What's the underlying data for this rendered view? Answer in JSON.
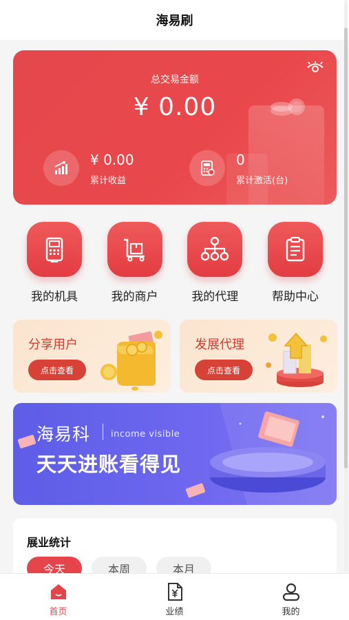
{
  "header": {
    "title": "海易刷"
  },
  "summary": {
    "total_label": "总交易金额",
    "total_amount": "¥ 0.00",
    "earnings_value": "¥ 0.00",
    "earnings_label": "累计收益",
    "activations_value": "0",
    "activations_label": "累计激活(台)"
  },
  "actions": [
    {
      "label": "我的机具",
      "icon": "pos-terminal-icon"
    },
    {
      "label": "我的商户",
      "icon": "cart-icon"
    },
    {
      "label": "我的代理",
      "icon": "network-icon"
    },
    {
      "label": "帮助中心",
      "icon": "clipboard-icon"
    }
  ],
  "promos": [
    {
      "title": "分享用户",
      "button": "点击查看"
    },
    {
      "title": "发展代理",
      "button": "点击查看"
    }
  ],
  "banner": {
    "brand": "海易科",
    "english": "income visible",
    "slogan": "天天进账看得见"
  },
  "stats": {
    "title": "展业统计",
    "tabs": [
      "今天",
      "本周",
      "本月"
    ],
    "active_tab": 0
  },
  "nav": [
    {
      "label": "首页",
      "icon": "home-icon",
      "active": true
    },
    {
      "label": "业绩",
      "icon": "document-yen-icon",
      "active": false
    },
    {
      "label": "我的",
      "icon": "user-icon",
      "active": false
    }
  ],
  "colors": {
    "primary": "#e5454a",
    "banner": "#6663ec",
    "promo_bg": "#fce7d3"
  }
}
